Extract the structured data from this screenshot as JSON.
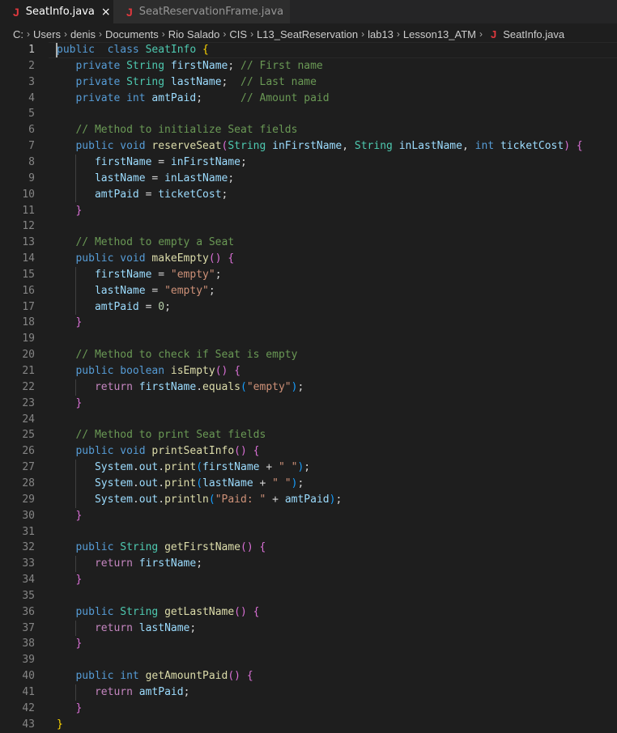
{
  "tabs": [
    {
      "label": "SeatInfo.java",
      "icon": "java-file-icon",
      "active": true,
      "close": "×"
    },
    {
      "label": "SeatReservationFrame.java",
      "icon": "java-file-icon",
      "active": false
    }
  ],
  "java_icon_glyph": "J",
  "breadcrumbs": [
    "C:",
    "Users",
    "denis",
    "Documents",
    "Rio Salado",
    "CIS",
    "L13_SeatReservation",
    "lab13",
    "Lesson13_ATM",
    "SeatInfo.java"
  ],
  "breadcrumb_separator": "›",
  "colors": {
    "background": "#1e1e1e",
    "keyword": "#569cd6",
    "type": "#4ec9b0",
    "function": "#dcdcaa",
    "variable": "#9cdcfe",
    "comment": "#6a9955",
    "string": "#ce9178",
    "number": "#b5cea8",
    "control": "#c586c0",
    "java_icon": "#e0383e"
  },
  "editor": {
    "current_line": 1,
    "lines": [
      {
        "n": "1",
        "indent": 0,
        "tokens": [
          [
            "kw",
            "public"
          ],
          [
            "",
            "  "
          ],
          [
            "kw",
            "class"
          ],
          [
            "",
            " "
          ],
          [
            "ty",
            "SeatInfo"
          ],
          [
            "",
            " "
          ],
          [
            "b1",
            "{"
          ]
        ]
      },
      {
        "n": "2",
        "indent": 1,
        "tokens": [
          [
            "kw",
            "private"
          ],
          [
            "",
            " "
          ],
          [
            "ty",
            "String"
          ],
          [
            "",
            " "
          ],
          [
            "fld",
            "firstName"
          ],
          [
            "",
            ";"
          ],
          [
            "",
            " "
          ],
          [
            "cm",
            "// First name"
          ]
        ]
      },
      {
        "n": "3",
        "indent": 1,
        "tokens": [
          [
            "kw",
            "private"
          ],
          [
            "",
            " "
          ],
          [
            "ty",
            "String"
          ],
          [
            "",
            " "
          ],
          [
            "fld",
            "lastName"
          ],
          [
            "",
            ";"
          ],
          [
            "",
            "  "
          ],
          [
            "cm",
            "// Last name"
          ]
        ]
      },
      {
        "n": "4",
        "indent": 1,
        "tokens": [
          [
            "kw",
            "private"
          ],
          [
            "",
            " "
          ],
          [
            "kw",
            "int"
          ],
          [
            "",
            " "
          ],
          [
            "fld",
            "amtPaid"
          ],
          [
            "",
            ";"
          ],
          [
            "",
            "      "
          ],
          [
            "cm",
            "// Amount paid"
          ]
        ]
      },
      {
        "n": "5",
        "indent": 0,
        "tokens": []
      },
      {
        "n": "6",
        "indent": 1,
        "tokens": [
          [
            "cm",
            "// Method to initialize Seat fields"
          ]
        ]
      },
      {
        "n": "7",
        "indent": 1,
        "tokens": [
          [
            "kw",
            "public"
          ],
          [
            "",
            " "
          ],
          [
            "kw",
            "void"
          ],
          [
            "",
            " "
          ],
          [
            "fn",
            "reserveSeat"
          ],
          [
            "b2",
            "("
          ],
          [
            "ty",
            "String"
          ],
          [
            "",
            " "
          ],
          [
            "var",
            "inFirstName"
          ],
          [
            "",
            ", "
          ],
          [
            "ty",
            "String"
          ],
          [
            "",
            " "
          ],
          [
            "var",
            "inLastName"
          ],
          [
            "",
            ", "
          ],
          [
            "kw",
            "int"
          ],
          [
            "",
            " "
          ],
          [
            "var",
            "ticketCost"
          ],
          [
            "b2",
            ")"
          ],
          [
            "",
            " "
          ],
          [
            "b2",
            "{"
          ]
        ]
      },
      {
        "n": "8",
        "indent": 2,
        "tokens": [
          [
            "var",
            "firstName"
          ],
          [
            "",
            " = "
          ],
          [
            "var",
            "inFirstName"
          ],
          [
            "",
            ";"
          ]
        ]
      },
      {
        "n": "9",
        "indent": 2,
        "tokens": [
          [
            "var",
            "lastName"
          ],
          [
            "",
            " = "
          ],
          [
            "var",
            "inLastName"
          ],
          [
            "",
            ";"
          ]
        ]
      },
      {
        "n": "10",
        "indent": 2,
        "tokens": [
          [
            "var",
            "amtPaid"
          ],
          [
            "",
            " = "
          ],
          [
            "var",
            "ticketCost"
          ],
          [
            "",
            ";"
          ]
        ]
      },
      {
        "n": "11",
        "indent": 1,
        "tokens": [
          [
            "b2",
            "}"
          ]
        ]
      },
      {
        "n": "12",
        "indent": 0,
        "tokens": []
      },
      {
        "n": "13",
        "indent": 1,
        "tokens": [
          [
            "cm",
            "// Method to empty a Seat"
          ]
        ]
      },
      {
        "n": "14",
        "indent": 1,
        "tokens": [
          [
            "kw",
            "public"
          ],
          [
            "",
            " "
          ],
          [
            "kw",
            "void"
          ],
          [
            "",
            " "
          ],
          [
            "fn",
            "makeEmpty"
          ],
          [
            "b2",
            "()"
          ],
          [
            "",
            " "
          ],
          [
            "b2",
            "{"
          ]
        ]
      },
      {
        "n": "15",
        "indent": 2,
        "tokens": [
          [
            "var",
            "firstName"
          ],
          [
            "",
            " = "
          ],
          [
            "str",
            "\"empty\""
          ],
          [
            "",
            ";"
          ]
        ]
      },
      {
        "n": "16",
        "indent": 2,
        "tokens": [
          [
            "var",
            "lastName"
          ],
          [
            "",
            " = "
          ],
          [
            "str",
            "\"empty\""
          ],
          [
            "",
            ";"
          ]
        ]
      },
      {
        "n": "17",
        "indent": 2,
        "tokens": [
          [
            "var",
            "amtPaid"
          ],
          [
            "",
            " = "
          ],
          [
            "num",
            "0"
          ],
          [
            "",
            ";"
          ]
        ]
      },
      {
        "n": "18",
        "indent": 1,
        "tokens": [
          [
            "b2",
            "}"
          ]
        ]
      },
      {
        "n": "19",
        "indent": 0,
        "tokens": []
      },
      {
        "n": "20",
        "indent": 1,
        "tokens": [
          [
            "cm",
            "// Method to check if Seat is empty"
          ]
        ]
      },
      {
        "n": "21",
        "indent": 1,
        "tokens": [
          [
            "kw",
            "public"
          ],
          [
            "",
            " "
          ],
          [
            "kw",
            "boolean"
          ],
          [
            "",
            " "
          ],
          [
            "fn",
            "isEmpty"
          ],
          [
            "b2",
            "()"
          ],
          [
            "",
            " "
          ],
          [
            "b2",
            "{"
          ]
        ]
      },
      {
        "n": "22",
        "indent": 2,
        "tokens": [
          [
            "ctl",
            "return"
          ],
          [
            "",
            " "
          ],
          [
            "var",
            "firstName"
          ],
          [
            "",
            "."
          ],
          [
            "fn",
            "equals"
          ],
          [
            "b3",
            "("
          ],
          [
            "str",
            "\"empty\""
          ],
          [
            "b3",
            ")"
          ],
          [
            "",
            ";"
          ]
        ]
      },
      {
        "n": "23",
        "indent": 1,
        "tokens": [
          [
            "b2",
            "}"
          ]
        ]
      },
      {
        "n": "24",
        "indent": 0,
        "tokens": []
      },
      {
        "n": "25",
        "indent": 1,
        "tokens": [
          [
            "cm",
            "// Method to print Seat fields"
          ]
        ]
      },
      {
        "n": "26",
        "indent": 1,
        "tokens": [
          [
            "kw",
            "public"
          ],
          [
            "",
            " "
          ],
          [
            "kw",
            "void"
          ],
          [
            "",
            " "
          ],
          [
            "fn",
            "printSeatInfo"
          ],
          [
            "b2",
            "()"
          ],
          [
            "",
            " "
          ],
          [
            "b2",
            "{"
          ]
        ]
      },
      {
        "n": "27",
        "indent": 2,
        "tokens": [
          [
            "var",
            "System"
          ],
          [
            "",
            "."
          ],
          [
            "var",
            "out"
          ],
          [
            "",
            "."
          ],
          [
            "fn",
            "print"
          ],
          [
            "b3",
            "("
          ],
          [
            "var",
            "firstName"
          ],
          [
            "",
            " + "
          ],
          [
            "str",
            "\" \""
          ],
          [
            "b3",
            ")"
          ],
          [
            "",
            ";"
          ]
        ]
      },
      {
        "n": "28",
        "indent": 2,
        "tokens": [
          [
            "var",
            "System"
          ],
          [
            "",
            "."
          ],
          [
            "var",
            "out"
          ],
          [
            "",
            "."
          ],
          [
            "fn",
            "print"
          ],
          [
            "b3",
            "("
          ],
          [
            "var",
            "lastName"
          ],
          [
            "",
            " + "
          ],
          [
            "str",
            "\" \""
          ],
          [
            "b3",
            ")"
          ],
          [
            "",
            ";"
          ]
        ]
      },
      {
        "n": "29",
        "indent": 2,
        "tokens": [
          [
            "var",
            "System"
          ],
          [
            "",
            "."
          ],
          [
            "var",
            "out"
          ],
          [
            "",
            "."
          ],
          [
            "fn",
            "println"
          ],
          [
            "b3",
            "("
          ],
          [
            "str",
            "\"Paid: \""
          ],
          [
            "",
            " + "
          ],
          [
            "var",
            "amtPaid"
          ],
          [
            "b3",
            ")"
          ],
          [
            "",
            ";"
          ]
        ]
      },
      {
        "n": "30",
        "indent": 1,
        "tokens": [
          [
            "b2",
            "}"
          ]
        ]
      },
      {
        "n": "31",
        "indent": 0,
        "tokens": []
      },
      {
        "n": "32",
        "indent": 1,
        "tokens": [
          [
            "kw",
            "public"
          ],
          [
            "",
            " "
          ],
          [
            "ty",
            "String"
          ],
          [
            "",
            " "
          ],
          [
            "fn",
            "getFirstName"
          ],
          [
            "b2",
            "()"
          ],
          [
            "",
            " "
          ],
          [
            "b2",
            "{"
          ]
        ]
      },
      {
        "n": "33",
        "indent": 2,
        "tokens": [
          [
            "ctl",
            "return"
          ],
          [
            "",
            " "
          ],
          [
            "var",
            "firstName"
          ],
          [
            "",
            ";"
          ]
        ]
      },
      {
        "n": "34",
        "indent": 1,
        "tokens": [
          [
            "b2",
            "}"
          ]
        ]
      },
      {
        "n": "35",
        "indent": 0,
        "tokens": []
      },
      {
        "n": "36",
        "indent": 1,
        "tokens": [
          [
            "kw",
            "public"
          ],
          [
            "",
            " "
          ],
          [
            "ty",
            "String"
          ],
          [
            "",
            " "
          ],
          [
            "fn",
            "getLastName"
          ],
          [
            "b2",
            "()"
          ],
          [
            "",
            " "
          ],
          [
            "b2",
            "{"
          ]
        ]
      },
      {
        "n": "37",
        "indent": 2,
        "tokens": [
          [
            "ctl",
            "return"
          ],
          [
            "",
            " "
          ],
          [
            "var",
            "lastName"
          ],
          [
            "",
            ";"
          ]
        ]
      },
      {
        "n": "38",
        "indent": 1,
        "tokens": [
          [
            "b2",
            "}"
          ]
        ]
      },
      {
        "n": "39",
        "indent": 0,
        "tokens": []
      },
      {
        "n": "40",
        "indent": 1,
        "tokens": [
          [
            "kw",
            "public"
          ],
          [
            "",
            " "
          ],
          [
            "kw",
            "int"
          ],
          [
            "",
            " "
          ],
          [
            "fn",
            "getAmountPaid"
          ],
          [
            "b2",
            "()"
          ],
          [
            "",
            " "
          ],
          [
            "b2",
            "{"
          ]
        ]
      },
      {
        "n": "41",
        "indent": 2,
        "tokens": [
          [
            "ctl",
            "return"
          ],
          [
            "",
            " "
          ],
          [
            "var",
            "amtPaid"
          ],
          [
            "",
            ";"
          ]
        ]
      },
      {
        "n": "42",
        "indent": 1,
        "tokens": [
          [
            "b2",
            "}"
          ]
        ]
      },
      {
        "n": "43",
        "indent": 0,
        "tokens": [
          [
            "b1",
            "}"
          ]
        ]
      }
    ]
  }
}
